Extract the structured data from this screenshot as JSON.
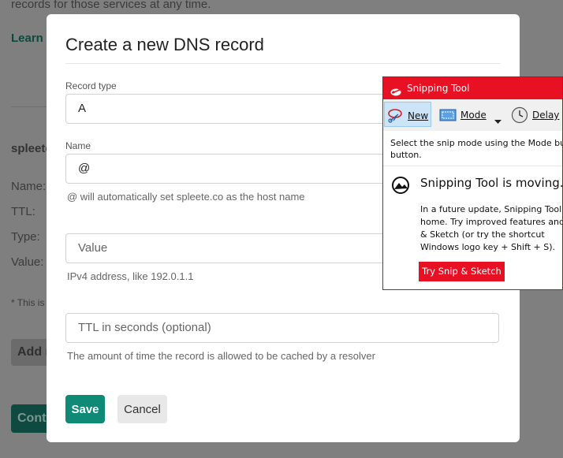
{
  "background": {
    "intro_text": "records for those services at any time.",
    "learn_link": "Learn",
    "record_heading": "spleete",
    "detail_labels": [
      "Name:",
      "TTL:",
      "Type:",
      "Value:"
    ],
    "footnote": "* This is",
    "add_button": "Add r",
    "continue_button": "Conti"
  },
  "modal": {
    "title": "Create a new DNS record",
    "record_type": {
      "label": "Record type",
      "value": "A"
    },
    "name": {
      "label": "Name",
      "value": "@",
      "help": "@ will automatically set spleete.co as the host name"
    },
    "value_field": {
      "placeholder": "Value",
      "help": "IPv4 address, like 192.0.1.1"
    },
    "ttl_field": {
      "placeholder": "TTL in seconds (optional)",
      "help": "The amount of time the record is allowed to be cached by a resolver"
    },
    "save_label": "Save",
    "cancel_label": "Cancel"
  },
  "snipping_tool": {
    "title": "Snipping Tool",
    "toolbar": {
      "new_label": "New",
      "mode_label": "Mode",
      "delay_label": "Delay"
    },
    "instructions": [
      "Select the snip mode using the Mode butt",
      "button."
    ],
    "heading": "Snipping Tool is moving...",
    "paragraph": [
      "In a future update, Snipping Tool w",
      "home. Try improved features and sn",
      "& Sketch (or try the shortcut",
      "Windows logo key + Shift + S)."
    ],
    "try_button": "Try Snip & Sketch",
    "icons": [
      "scissors-icon",
      "new-snip-icon",
      "mode-icon",
      "dropdown-arrow-icon",
      "clock-icon",
      "snip-sketch-icon"
    ],
    "accent_color": "#e81123"
  },
  "colors": {
    "save_button": "#0e8a77",
    "overlay": "#7f7f7f"
  }
}
